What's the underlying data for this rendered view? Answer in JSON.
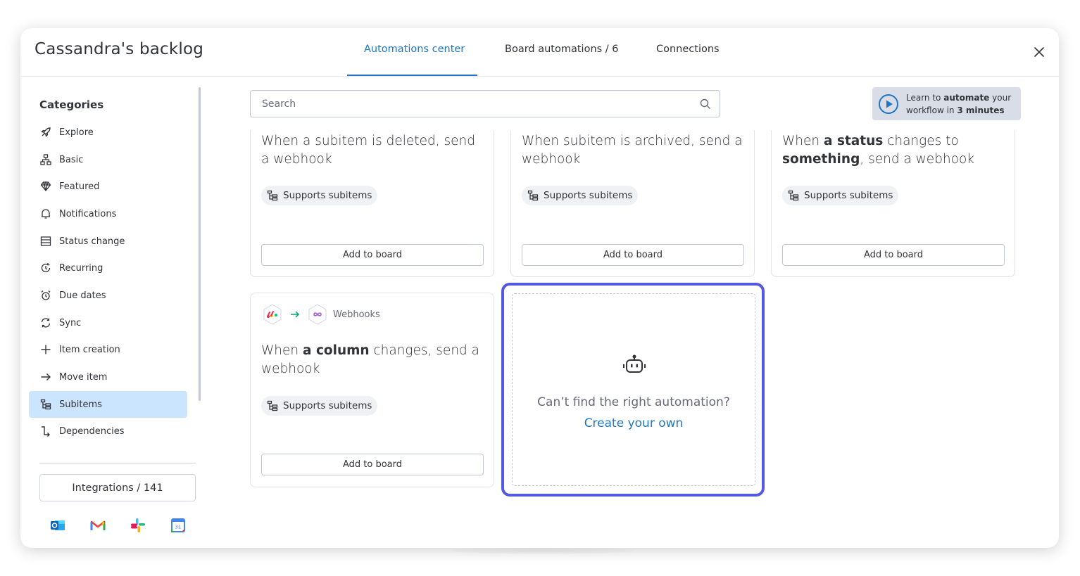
{
  "header": {
    "board_title": "Cassandra's backlog",
    "tabs": [
      {
        "label": "Automations center",
        "active": true
      },
      {
        "label": "Board automations / 6",
        "active": false
      },
      {
        "label": "Connections",
        "active": false
      }
    ],
    "close_icon": "close-icon"
  },
  "sidebar": {
    "title": "Categories",
    "items": [
      {
        "label": "Explore",
        "icon": "rocket-icon"
      },
      {
        "label": "Basic",
        "icon": "sitemap-icon"
      },
      {
        "label": "Featured",
        "icon": "diamond-icon"
      },
      {
        "label": "Notifications",
        "icon": "bell-icon"
      },
      {
        "label": "Status change",
        "icon": "status-list-icon"
      },
      {
        "label": "Recurring",
        "icon": "recurring-icon"
      },
      {
        "label": "Due dates",
        "icon": "alarm-icon"
      },
      {
        "label": "Sync",
        "icon": "sync-icon"
      },
      {
        "label": "Item creation",
        "icon": "plus-icon"
      },
      {
        "label": "Move item",
        "icon": "arrow-right-icon"
      },
      {
        "label": "Subitems",
        "icon": "subitems-icon",
        "active": true
      },
      {
        "label": "Dependencies",
        "icon": "dependency-icon"
      }
    ],
    "integrations_label": "Integrations / 141",
    "integration_icons": [
      "outlook-icon",
      "gmail-icon",
      "slack-icon",
      "google-calendar-icon"
    ]
  },
  "search": {
    "placeholder": "Search",
    "value": ""
  },
  "learn_banner": {
    "pre": "Learn to ",
    "bold1": "automate",
    "mid": " your",
    "line2_pre": "workflow in ",
    "bold2": "3 minutes"
  },
  "cards": [
    {
      "title_plain": "When a subitem is deleted, send a webhook",
      "pill": "Supports subitems",
      "button": "Add to board"
    },
    {
      "title_plain": "When subitem is archived, send a webhook",
      "pill": "Supports subitems",
      "button": "Add to board"
    },
    {
      "title_p1": "When ",
      "title_b1": "a status",
      "title_p2": " changes to ",
      "title_b2": "something",
      "title_p3": ", send a webhook",
      "pill": "Supports subitems",
      "button": "Add to board"
    },
    {
      "logo_label": "Webhooks",
      "title_p1": "When ",
      "title_b1": "a column",
      "title_p2": " changes, send a webhook",
      "pill": "Supports subitems",
      "button": "Add to board"
    }
  ],
  "create_own": {
    "question": "Can’t find the right automation?",
    "link": "Create your own"
  },
  "colors": {
    "accent": "#1f76c2",
    "highlight": "#5559df",
    "active_bg": "#cce5ff"
  }
}
